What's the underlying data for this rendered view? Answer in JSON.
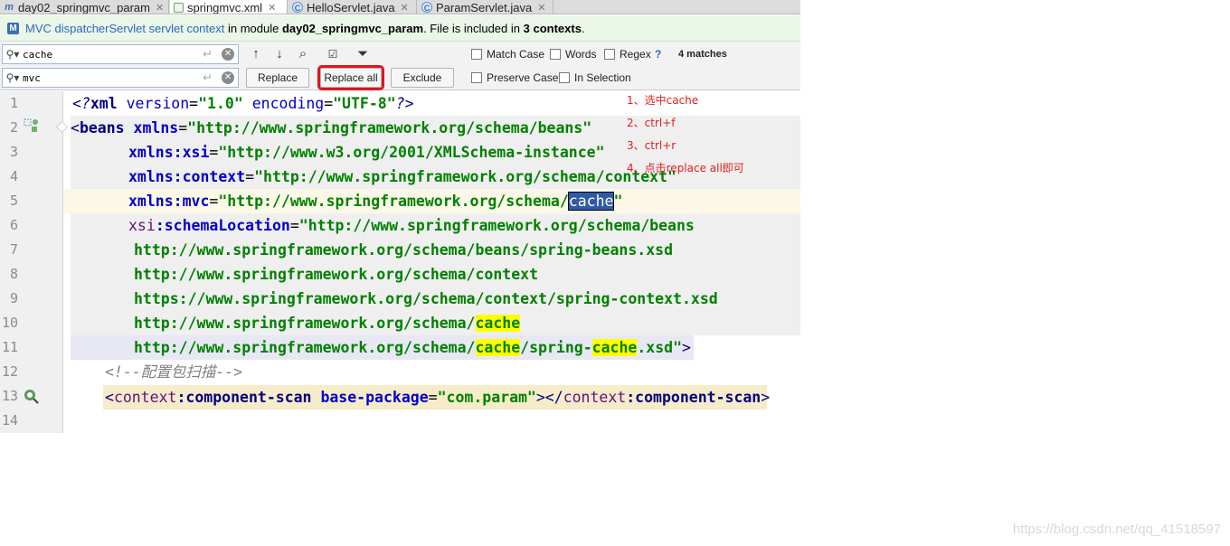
{
  "tabs": [
    {
      "label": "day02_springmvc_param",
      "icon": "maven-module-icon"
    },
    {
      "label": "springmvc.xml",
      "icon": "xml-file-icon",
      "active": true
    },
    {
      "label": "HelloServlet.java",
      "icon": "java-class-icon"
    },
    {
      "label": "ParamServlet.java",
      "icon": "java-class-icon"
    }
  ],
  "banner": {
    "link": "MVC dispatcherServlet servlet context",
    "text1": " in module ",
    "module": "day02_springmvc_param",
    "text2": ". File is included in ",
    "contexts": "3 contexts",
    "text3": "."
  },
  "find": {
    "search_value": "cache",
    "replace_value": "mvc",
    "replace_label": "Replace",
    "replace_all_label": "Replace all",
    "exclude_label": "Exclude",
    "match_case": "Match Case",
    "words": "Words",
    "regex": "Regex",
    "help": "?",
    "matches": "4 matches",
    "preserve_case": "Preserve Case",
    "in_selection": "In Selection"
  },
  "editor": {
    "line_numbers": [
      "1",
      "2",
      "3",
      "4",
      "5",
      "6",
      "7",
      "8",
      "9",
      "10",
      "11",
      "12",
      "13",
      "14"
    ],
    "lines": {
      "l1": [
        "<?",
        "xml ",
        "version",
        "=",
        "\"1.0\"",
        " encoding",
        "=",
        "\"UTF-8\"",
        "?>"
      ],
      "l2": [
        "<",
        "beans ",
        "xmlns",
        "=",
        "\"http://www.springframework.org/schema/beans\""
      ],
      "l3": [
        "xmlns",
        ":xsi",
        "=",
        "\"http://www.w3.org/2001/XMLSchema-instance\""
      ],
      "l4": [
        "xmlns",
        ":context",
        "=",
        "\"http://www.springframework.org/schema/context\""
      ],
      "l5": [
        "xmlns",
        ":mvc",
        "=",
        "\"http://www.springframework.org/schema/",
        "cache",
        "\""
      ],
      "l6": [
        "xsi",
        ":schemaLocation",
        "=",
        "\"http://www.springframework.org/schema/beans"
      ],
      "l7": "http://www.springframework.org/schema/beans/spring-beans.xsd",
      "l8": "http://www.springframework.org/schema/context",
      "l9": "https://www.springframework.org/schema/context/spring-context.xsd",
      "l10": [
        "http://www.springframework.org/schema/",
        "cache"
      ],
      "l11": [
        "http://www.springframework.org/schema/",
        "cache",
        "/spring-",
        "cache",
        ".xsd\"",
        ">"
      ],
      "l12": "<!--配置包扫描-->",
      "l13": [
        "<",
        "context",
        ":component-scan ",
        "base-package",
        "=",
        "\"com.param\"",
        "></",
        "context",
        ":component-scan",
        ">"
      ]
    }
  },
  "notes": [
    "1、选中cache",
    "2、ctrl+f",
    "3、ctrl+r",
    "4、点击replace all即可"
  ],
  "watermark": "https://blog.csdn.net/qq_41518597",
  "colors": {
    "highlight": "#ffff00",
    "selection": "#2f5aa8",
    "annotation": "#e02020",
    "string": "#008000",
    "tag": "#000080"
  }
}
